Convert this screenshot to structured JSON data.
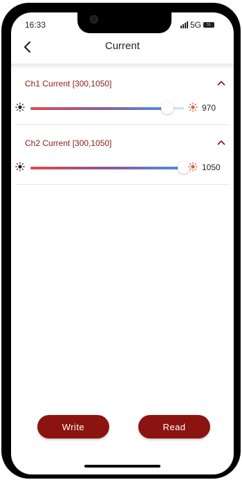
{
  "status_bar": {
    "time": "16:33",
    "network": "5G",
    "battery_label": "51"
  },
  "header": {
    "title": "Current",
    "back_icon": "chevron-left-icon"
  },
  "channels": [
    {
      "label": "Ch1 Current [300,1050]",
      "min": 300,
      "max": 1050,
      "value": "970",
      "value_num": 970,
      "expanded": true
    },
    {
      "label": "Ch2 Current [300,1050]",
      "min": 300,
      "max": 1050,
      "value": "1050",
      "value_num": 1050,
      "expanded": true
    }
  ],
  "buttons": {
    "write_label": "Write",
    "read_label": "Read"
  },
  "colors": {
    "accent": "#8b1410",
    "section_title": "#8b1a1a",
    "slider_start": "#e04848",
    "slider_end": "#4a8fe0",
    "sun_icon_right": "#e05a3a"
  }
}
